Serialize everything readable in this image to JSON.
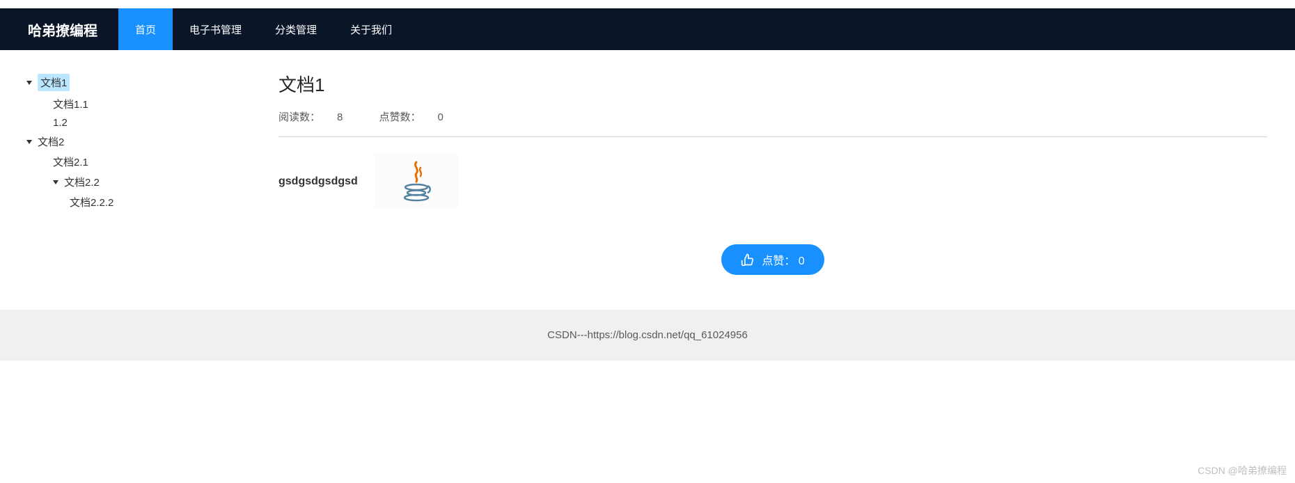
{
  "navbar": {
    "brand": "哈弟撩编程",
    "items": [
      {
        "label": "首页",
        "active": true
      },
      {
        "label": "电子书管理",
        "active": false
      },
      {
        "label": "分类管理",
        "active": false
      },
      {
        "label": "关于我们",
        "active": false
      }
    ]
  },
  "sidebar": {
    "tree": [
      {
        "label": "文档1",
        "selected": true
      },
      {
        "label": "文档1.1"
      },
      {
        "label": "1.2"
      },
      {
        "label": "文档2"
      },
      {
        "label": "文档2.1"
      },
      {
        "label": "文档2.2"
      },
      {
        "label": "文档2.2.2"
      }
    ]
  },
  "content": {
    "title": "文档1",
    "read_label": "阅读数：",
    "read_count": "8",
    "like_label": "点赞数：",
    "like_count": "0",
    "body_text": "gsdgsdgsdgsd",
    "icon_name": "java-icon"
  },
  "like_button": {
    "label": "点赞：",
    "count": "0"
  },
  "footer": {
    "text": "CSDN---https://blog.csdn.net/qq_61024956"
  },
  "watermark": "CSDN @哈弟撩编程"
}
